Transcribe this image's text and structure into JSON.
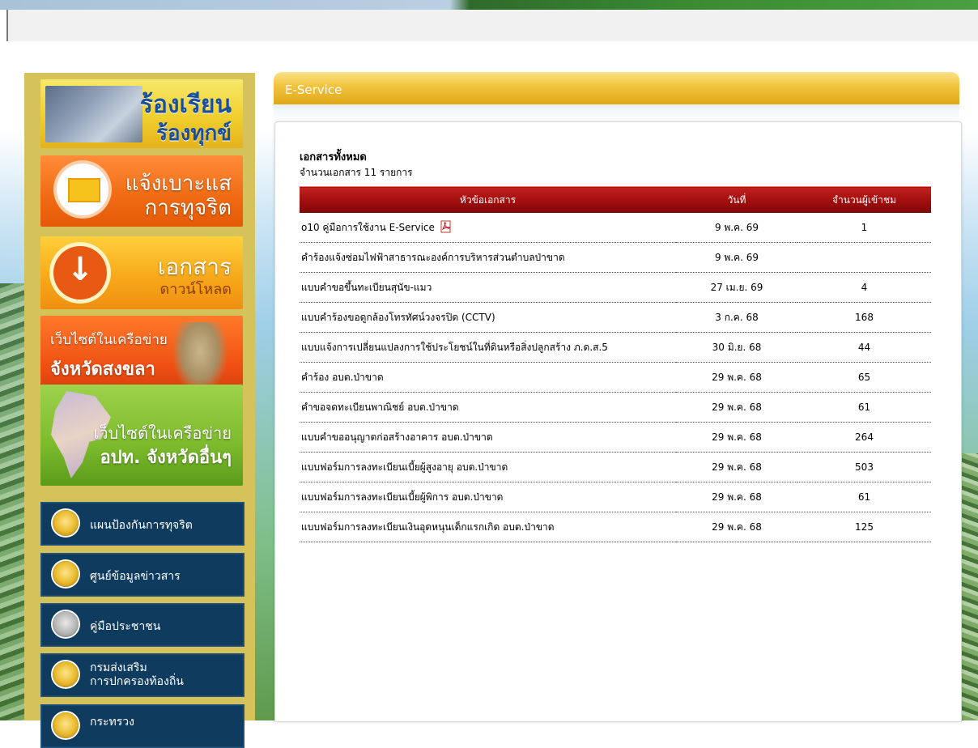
{
  "sidebar": {
    "banners": {
      "complaint": {
        "line1": "ร้องเรียน",
        "line2": "ร้องทุกข์"
      },
      "corruption": {
        "line1": "แจ้งเบาะแส",
        "line2": "การทุจริต"
      },
      "download": {
        "line1": "เอกสาร",
        "line2": "ดาวน์โหลด"
      },
      "songkhla": {
        "line1": "เว็บไซต์ในเครือข่าย",
        "line2": "จังหวัดสงขลา"
      },
      "other_province": {
        "line1": "เว็บไซต์ในเครือข่าย",
        "line2": "อปท. จังหวัดอื่นๆ"
      }
    },
    "nav": [
      {
        "label": "แผนป้องกันการทุจริต"
      },
      {
        "label": "ศูนย์ข้อมูลข่าวสาร"
      },
      {
        "label": "คู่มือประชาชน"
      },
      {
        "line1": "กรมส่งเสริม",
        "line2": "การปกครองท้องถิ่น"
      },
      {
        "label": "กระทรวง"
      }
    ]
  },
  "content": {
    "tab_title": "E-Service",
    "heading": "เอกสารทั้งหมด",
    "count_text": "จำนวนเอกสาร 11 รายการ",
    "columns": [
      "หัวข้อเอกสาร",
      "วันที่",
      "จำนวนผู้เข้าชม"
    ],
    "rows": [
      {
        "title": "o10 คู่มือการใช้งาน E-Service",
        "date": "9 พ.ค. 69",
        "views": "1",
        "pdf_icon": "pdf-icon"
      },
      {
        "title": "คำร้องแจ้งซ่อมไฟฟ้าสาธารณะองค์การบริหารส่วนตำบลป่าขาด",
        "date": "9 พ.ค. 69",
        "views": ""
      },
      {
        "title": "แบบคำขอขึ้นทะเบียนสุนัข-แมว",
        "date": "27 เม.ย. 69",
        "views": "4"
      },
      {
        "title": "แบบคำร้องขอดูกล้องโทรทัศน์วงจรปิด (CCTV)",
        "date": "3 ก.ค. 68",
        "views": "168"
      },
      {
        "title": "แบบแจ้งการเปลี่ยนแปลงการใช้ประโยชน์ในที่ดินหรือสิ่งปลูกสร้าง ภ.ด.ส.5",
        "date": "30 มิ.ย. 68",
        "views": "44"
      },
      {
        "title": "คำร้อง อบต.ป่าขาด",
        "date": "29 พ.ค. 68",
        "views": "65"
      },
      {
        "title": "คำขอจดทะเบียนพาณิชย์ อบต.ป่าขาด",
        "date": "29 พ.ค. 68",
        "views": "61"
      },
      {
        "title": "แบบคำขออนุญาตก่อสร้างอาคาร อบต.ป่าขาด",
        "date": "29 พ.ค. 68",
        "views": "264"
      },
      {
        "title": "แบบฟอร์มการลงทะเบียนเบี้ยผู้สูงอายุ อบต.ป่าขาด",
        "date": "29 พ.ค. 68",
        "views": "503"
      },
      {
        "title": "แบบฟอร์มการลงทะเบียนเบี้ยผู้พิการ อบต.ป่าขาด",
        "date": "29 พ.ค. 68",
        "views": "61"
      },
      {
        "title": "แบบฟอร์มการลงทะเบียนเงินอุดหนุนเด็กแรกเกิด อบต.ป่าขาด",
        "date": "29 พ.ค. 68",
        "views": "125"
      }
    ]
  },
  "colors": {
    "header_red": "#a10d0d",
    "tab_gold": "#f2c541",
    "sidebar_gold": "#d6c25a",
    "nav_blue": "#0f3b5e"
  }
}
